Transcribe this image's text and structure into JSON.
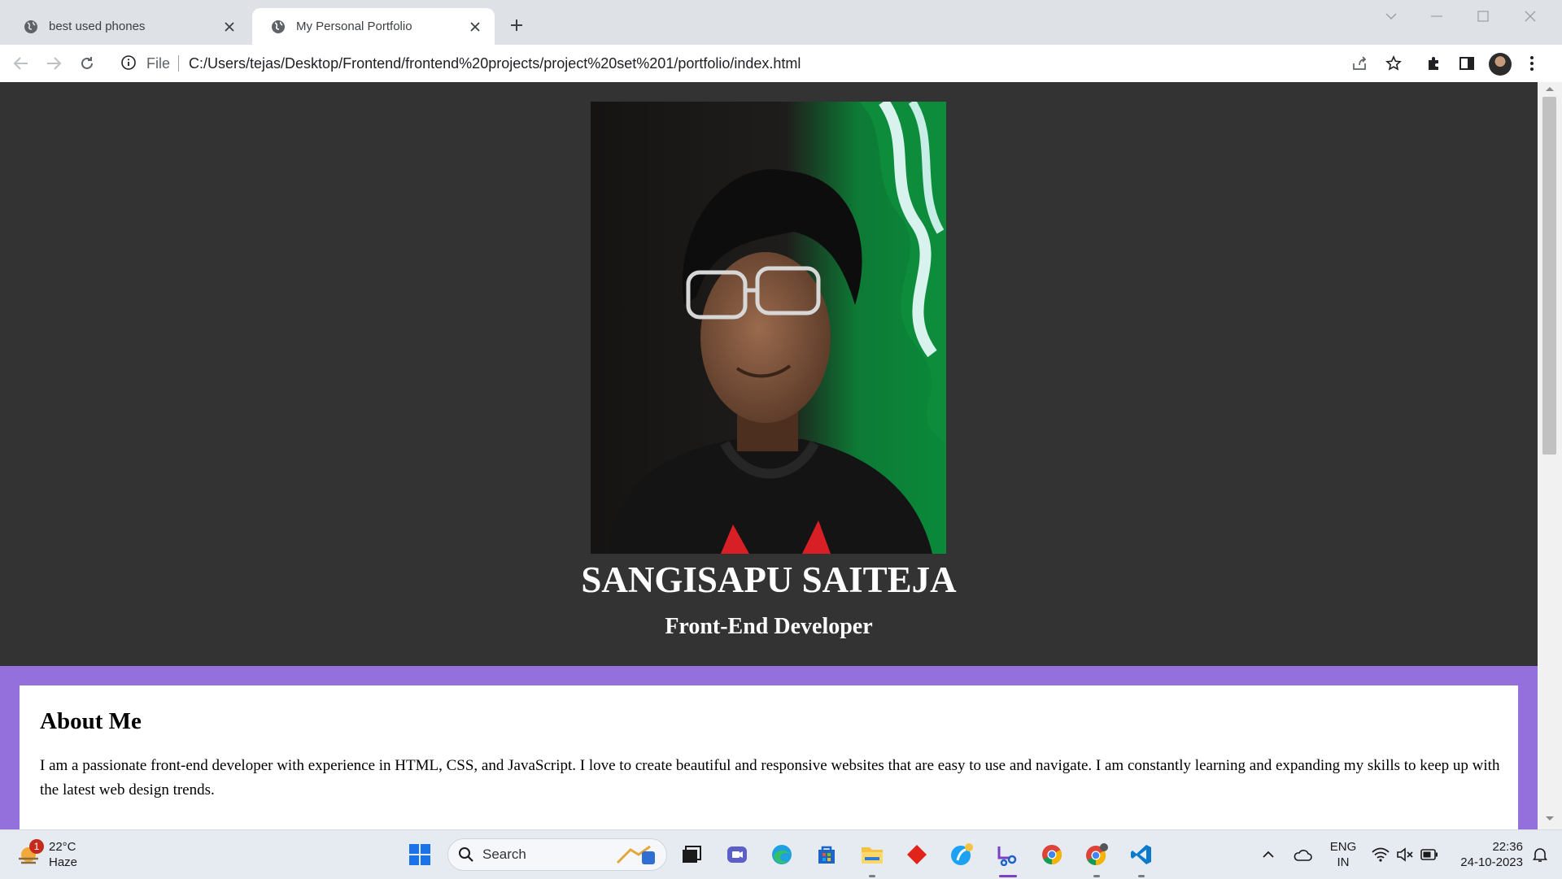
{
  "browser": {
    "tabs": [
      {
        "title": "best used phones",
        "active": false
      },
      {
        "title": "My Personal Portfolio",
        "active": true
      }
    ],
    "address": {
      "scheme": "File",
      "url": "C:/Users/tejas/Desktop/Frontend/frontend%20projects/project%20set%201/portfolio/index.html"
    }
  },
  "page": {
    "name": "SANGISAPU SAITEJA",
    "role": "Front-End Developer",
    "about": {
      "heading": "About Me",
      "text": "I am a passionate front-end developer with experience in HTML, CSS, and JavaScript. I love to create beautiful and responsive websites that are easy to use and navigate. I am constantly learning and expanding my skills to keep up with the latest web design trends."
    },
    "colors": {
      "hero_bg": "#333333",
      "about_bg": "#9370db"
    }
  },
  "taskbar": {
    "weather": {
      "temp": "22°C",
      "condition": "Haze",
      "badge": "1"
    },
    "search_label": "Search",
    "lang": {
      "line1": "ENG",
      "line2": "IN"
    },
    "clock": {
      "time": "22:36",
      "date": "24-10-2023"
    },
    "apps": [
      "start",
      "search",
      "task-view",
      "teams",
      "edge",
      "store",
      "file-explorer",
      "git-app",
      "skype-app",
      "snipping-tool",
      "chrome",
      "chrome-profile",
      "vscode"
    ]
  }
}
